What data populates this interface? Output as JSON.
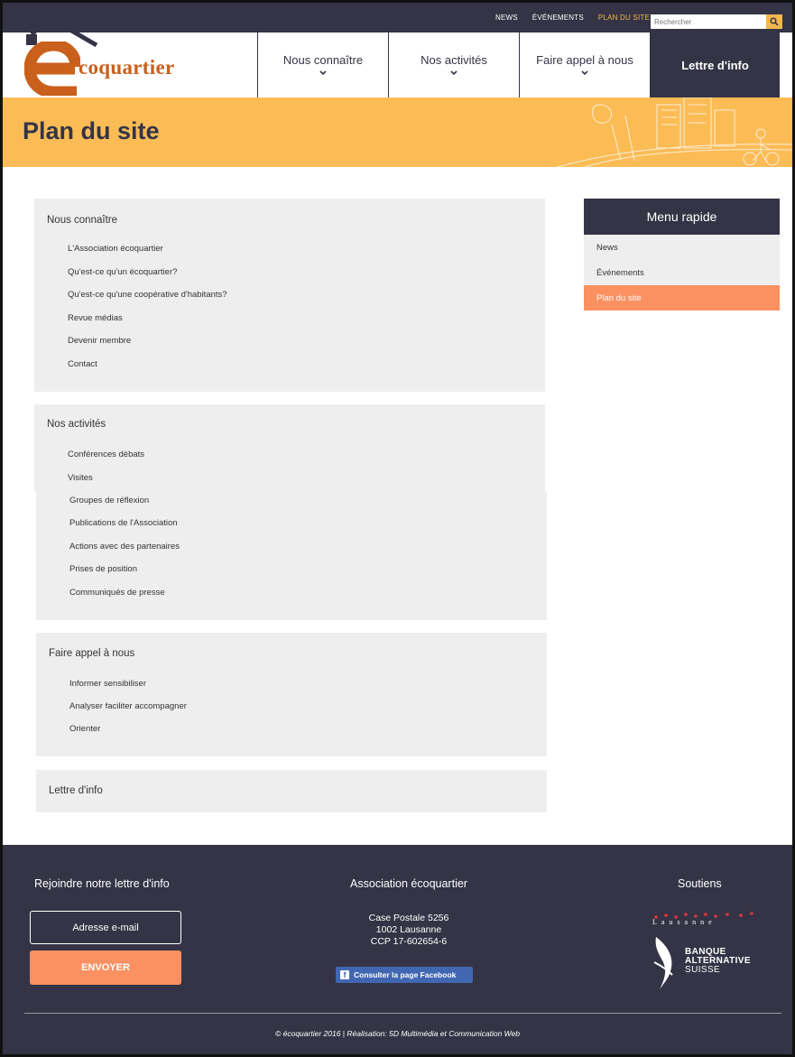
{
  "topbar": {
    "links": [
      "NEWS",
      "ÉVÉNEMENTS",
      "PLAN DU SITE"
    ],
    "active_link": "PLAN DU SITE",
    "search_placeholder": "Rechercher",
    "search_icon": "magnifier-icon"
  },
  "header": {
    "logo_letter": "e",
    "logo_text": "coquartier",
    "nav": [
      "Nous connaître",
      "Nos activités",
      "Faire appel à nous",
      "Lettre d'info"
    ]
  },
  "banner": {
    "title": "Plan du site"
  },
  "sitemap": {
    "sections": [
      {
        "title": "Nous connaître",
        "links": [
          "L'Association écoquartier",
          "Qu'est-ce qu'un écoquartier?",
          "Qu'est-ce qu'une coopérative d'habitants?",
          "Revue médias",
          "Devenir membre",
          "Contact"
        ]
      },
      {
        "title": "Nos activités",
        "links": [
          "Conférences débats",
          "Visites",
          "Groupes de réflexion",
          "Publications de l'Association",
          "Actions avec des partenaires",
          "Prises de position",
          "Communiqués de presse"
        ]
      },
      {
        "title": "Faire appel à nous",
        "links": [
          "Informer sensibiliser",
          "Analyser faciliter accompagner",
          "Orienter"
        ]
      },
      {
        "title": "Lettre d'info",
        "links": []
      }
    ]
  },
  "sidebar": {
    "title": "Menu rapide",
    "items": [
      "News",
      "Événements",
      "Plan du site"
    ],
    "active_item": "Plan du site"
  },
  "footer": {
    "newsletter_title": "Rejoindre notre lettre d'info",
    "email_placeholder": "Adresse e-mail",
    "send_label": "ENVOYER",
    "association_title": "Association écoquartier",
    "address_lines": [
      "Case Postale 5256",
      "1002 Lausanne",
      "CCP 17-602654-6"
    ],
    "facebook_label": "Consulter la page Facebook",
    "supporters_title": "Soutiens",
    "lausanne_logo": "Lausanne",
    "bas_lines": [
      "BANQUE",
      "ALTERNATIVE",
      "SUISSE"
    ],
    "copyright": "© écoquartier 2016 | Réalisation: 5D Multimédia et Communication Web"
  },
  "colors": {
    "navy": "#343446",
    "banner_yellow": "#fbbc56",
    "accent_orange": "#fb9161",
    "logo_brown": "#c9601b",
    "panel_grey": "#eeeeee",
    "facebook_blue": "#4267b2"
  }
}
